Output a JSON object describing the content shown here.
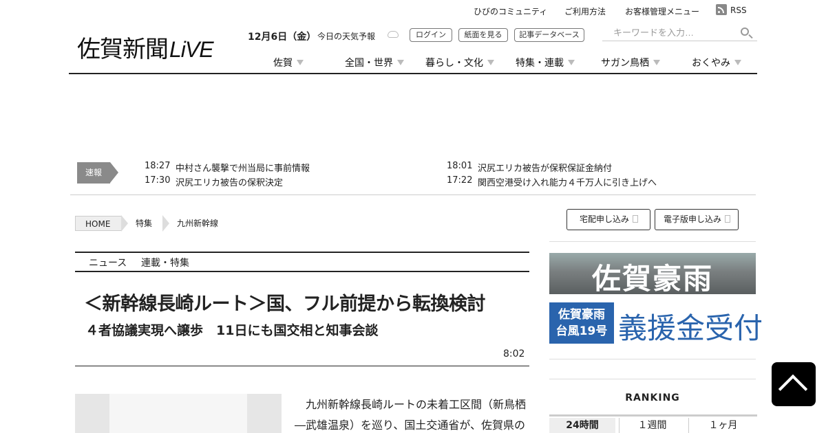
{
  "util_links": [
    {
      "label": "ひびのコミュニティ"
    },
    {
      "label": "ご利用方法"
    },
    {
      "label": "お客様管理メニュー"
    },
    {
      "label": "RSS"
    }
  ],
  "logo": {
    "main": "佐賀新聞",
    "suffix": "LiVE"
  },
  "date": "12月6日（金）",
  "weather_label": "今日の天気予報",
  "header_buttons": [
    "ログイン",
    "紙面を見る",
    "記事データベース"
  ],
  "search": {
    "placeholder": "キーワードを入力…"
  },
  "nav": [
    "佐賀",
    "全国・世界",
    "暮らし・文化",
    "特集・連載",
    "サガン鳥栖",
    "おくやみ"
  ],
  "breaking": {
    "label": "速報",
    "items": [
      {
        "time": "18:27",
        "title": "中村さん襲撃で州当局に事前情報"
      },
      {
        "time": "17:30",
        "title": "沢尻エリカ被告の保釈決定"
      },
      {
        "time": "18:01",
        "title": "沢尻エリカ被告が保釈保証金納付"
      },
      {
        "time": "17:22",
        "title": "関西空港受け入れ能力４千万人に引き上げへ"
      }
    ]
  },
  "breadcrumb": [
    "HOME",
    "特集",
    "九州新幹線"
  ],
  "subscribe": {
    "home_delivery": "宅配申し込み",
    "digital": "電子版申し込み"
  },
  "article": {
    "tabs": [
      "ニュース",
      "連載・特集"
    ],
    "headline": "＜新幹線長崎ルート＞国、フル前提から転換検討",
    "subhead": "４者協議実現へ譲歩　11日にも国交相と知事会談",
    "time": "8:02",
    "body": "九州新幹線長崎ルートの未着工区間（新鳥栖―武雄温泉）を巡り、国土交通省が、佐賀県の"
  },
  "sidebar": {
    "banner1": "佐賀豪雨",
    "banner2_left": [
      "佐賀豪雨",
      "台風19号"
    ],
    "banner2_right": "義援金受付",
    "ranking_title": "RANKING",
    "ranking_tabs": [
      "24時間",
      "１週間",
      "１ヶ月"
    ]
  }
}
